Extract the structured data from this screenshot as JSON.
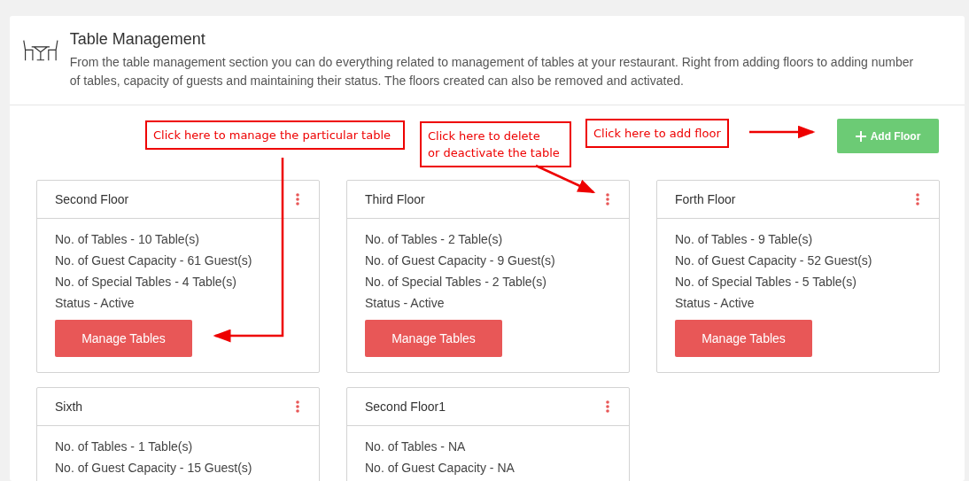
{
  "header": {
    "title": "Table Management",
    "description": "From the table management section you can do everything related to management of tables at your restaurant. Right from adding floors to adding number of tables, capacity of guests and maintaining their status. The floors created can also be removed and activated."
  },
  "add_button": {
    "label": "Add Floor"
  },
  "floors": [
    {
      "name": "Second Floor",
      "details": [
        "No. of Tables - 10 Table(s)",
        "No. of Guest Capacity - 61 Guest(s)",
        "No. of Special Tables - 4 Table(s)",
        "Status - Active"
      ],
      "button": "Manage Tables"
    },
    {
      "name": "Third Floor",
      "details": [
        "No. of Tables - 2 Table(s)",
        "No. of Guest Capacity - 9 Guest(s)",
        "No. of Special Tables - 2 Table(s)",
        "Status - Active"
      ],
      "button": "Manage Tables"
    },
    {
      "name": "Forth Floor",
      "details": [
        "No. of Tables - 9 Table(s)",
        "No. of Guest Capacity - 52 Guest(s)",
        "No. of Special Tables - 5 Table(s)",
        "Status - Active"
      ],
      "button": "Manage Tables"
    },
    {
      "name": "Sixth",
      "details": [
        "No. of Tables - 1 Table(s)",
        "No. of Guest Capacity - 15 Guest(s)"
      ]
    },
    {
      "name": "Second Floor1",
      "details": [
        "No. of Tables - NA",
        "No. of Guest Capacity - NA"
      ]
    }
  ],
  "annotations": [
    {
      "text": "Click here to manage the particular table"
    },
    {
      "text": "Click here to delete\nor deactivate the table"
    },
    {
      "text": "Click here to add floor"
    }
  ]
}
